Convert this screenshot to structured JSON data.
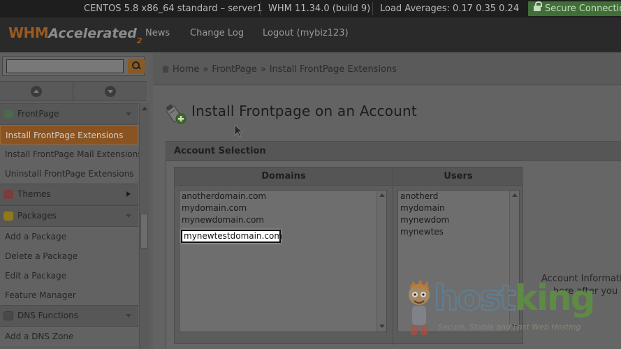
{
  "statusbar": {
    "server": "CENTOS 5.8 x86_64 standard – server1",
    "version": "WHM 11.34.0 (build 9)",
    "load": "Load Averages: 0.17 0.35 0.24",
    "secure": "Secure Connection"
  },
  "header": {
    "logo_main": "WHM",
    "logo_accel": "Accelerated",
    "logo_num": "2",
    "nav": [
      "News",
      "Change Log",
      "Logout (mybiz123)"
    ]
  },
  "sidebar": {
    "search_placeholder": "",
    "groups": {
      "frontpage": {
        "label": "FrontPage",
        "items": [
          "Install FrontPage Extensions",
          "Install FrontPage Mail Extensions",
          "Uninstall FrontPage Extensions"
        ]
      },
      "themes": {
        "label": "Themes"
      },
      "packages": {
        "label": "Packages",
        "items": [
          "Add a Package",
          "Delete a Package",
          "Edit a Package",
          "Feature Manager"
        ]
      },
      "dns": {
        "label": "DNS Functions",
        "items": [
          "Add a DNS Zone"
        ]
      }
    }
  },
  "breadcrumb": {
    "home": "Home",
    "section": "FrontPage",
    "current": "Install FrontPage Extensions",
    "separator": "»"
  },
  "main": {
    "title": "Install Frontpage on an Account",
    "panel_title": "Account Selection",
    "col_domains": "Domains",
    "col_users": "Users",
    "domains": [
      "anotherdomain.com",
      "mydomain.com",
      "mynewdomain.com"
    ],
    "highlighted_domain": "mynewtestdomain.com",
    "users": [
      "anotherd",
      "mydomain",
      "mynewdom",
      "mynewtes"
    ],
    "info_line1": "Account Informatio",
    "info_line2": "here after you se"
  },
  "watermark": {
    "brand_host": "host",
    "brand_king": "king",
    "tagline": "Secure, Stable and Fast Web Hosting"
  },
  "colors": {
    "accent_orange": "#8a5320",
    "secure_green": "#3f6f36",
    "topbar": "#1e1e1e"
  }
}
